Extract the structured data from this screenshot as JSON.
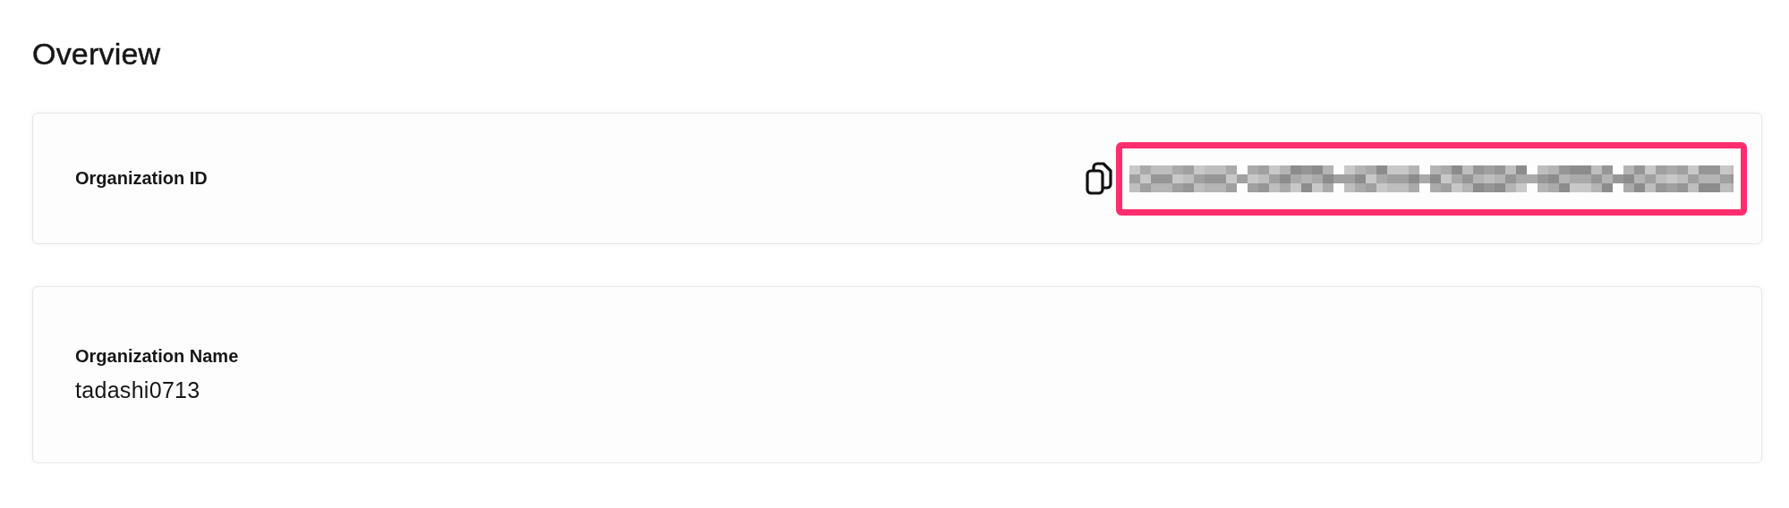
{
  "title": "Overview",
  "cards": [
    {
      "kind": "redacted-id",
      "label": "Organization ID"
    },
    {
      "kind": "text",
      "label": "Organization Name",
      "value": "tadashi0713"
    }
  ]
}
